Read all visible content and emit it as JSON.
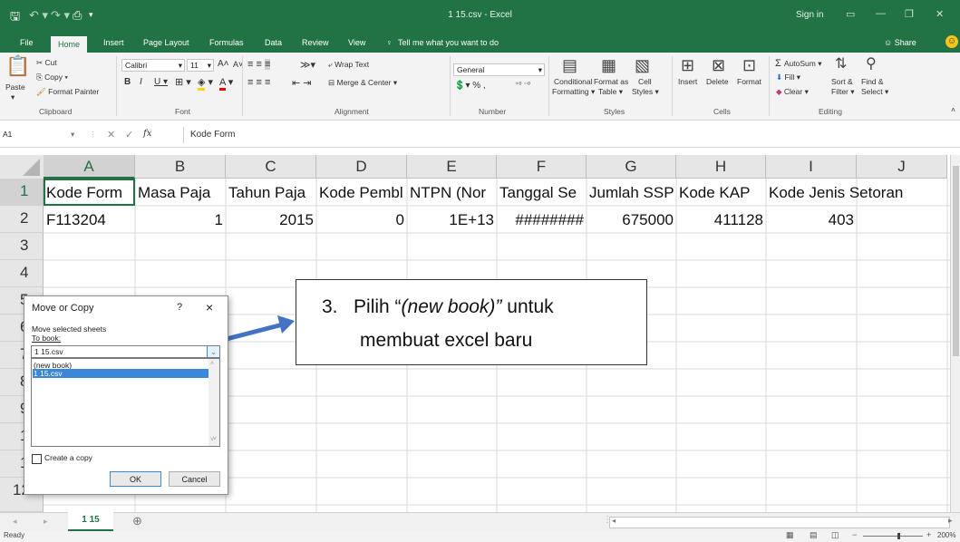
{
  "window": {
    "title": "1 15.csv - Excel",
    "sign_in": "Sign in"
  },
  "tabs": [
    "File",
    "Home",
    "Insert",
    "Page Layout",
    "Formulas",
    "Data",
    "Review",
    "View"
  ],
  "tell_me": "Tell me what you want to do",
  "share": "Share",
  "ribbon": {
    "clipboard": {
      "paste": "Paste",
      "cut": "Cut",
      "copy": "Copy",
      "format_painter": "Format Painter",
      "label": "Clipboard"
    },
    "font": {
      "name": "Calibri",
      "size": "11",
      "label": "Font"
    },
    "alignment": {
      "wrap_text": "Wrap Text",
      "merge_center": "Merge & Center",
      "label": "Alignment"
    },
    "number": {
      "format": "General",
      "label": "Number"
    },
    "styles": {
      "conditional_1": "Conditional",
      "conditional_2": "Formatting",
      "format_as_1": "Format as",
      "format_as_2": "Table",
      "cell_1": "Cell",
      "cell_2": "Styles",
      "label": "Styles"
    },
    "cells": {
      "insert": "Insert",
      "delete": "Delete",
      "format": "Format",
      "label": "Cells"
    },
    "editing": {
      "autosum": "AutoSum",
      "fill": "Fill",
      "clear": "Clear",
      "sort_1": "Sort &",
      "sort_2": "Filter",
      "find_1": "Find &",
      "find_2": "Select",
      "label": "Editing"
    }
  },
  "formula_bar": {
    "name_box": "A1",
    "fx": "fx",
    "content": "Kode Form"
  },
  "columns": [
    "A",
    "B",
    "C",
    "D",
    "E",
    "F",
    "G",
    "H",
    "I",
    "J"
  ],
  "rows": [
    "1",
    "2",
    "3",
    "4",
    "5",
    "6",
    "7",
    "8",
    "9",
    "10",
    "11",
    "12"
  ],
  "row1": [
    "Kode Form",
    "Masa Paja",
    "Tahun Paja",
    "Kode Pembl",
    "NTPN (Nor",
    "Tanggal Se",
    "Jumlah SSP",
    "Kode KAP",
    "Kode Jenis Setoran"
  ],
  "row2": [
    "F113204",
    "1",
    "2015",
    "0",
    "1E+13",
    "########",
    "675000",
    "411128",
    "403"
  ],
  "dialog": {
    "title": "Move or Copy",
    "help": "?",
    "close": "×",
    "move_label": "Move selected sheets",
    "to_book_label": "To book:",
    "to_book_value": "1 15.csv",
    "book_options": [
      "(new book)",
      "1 15.csv"
    ],
    "create_copy": "Create a copy",
    "ok": "OK",
    "cancel": "Cancel"
  },
  "callout": {
    "number": "3.",
    "line1_prefix": "Pilih “",
    "line1_italic": "(new book)”",
    "line1_suffix": " untuk",
    "line2": "membuat excel baru"
  },
  "sheet_tab": "1 15",
  "status": "Ready",
  "zoom": "200%",
  "colors": {
    "excel_green": "#217346",
    "selection_blue": "#3b88d8",
    "arrow_blue": "#4472c4"
  }
}
